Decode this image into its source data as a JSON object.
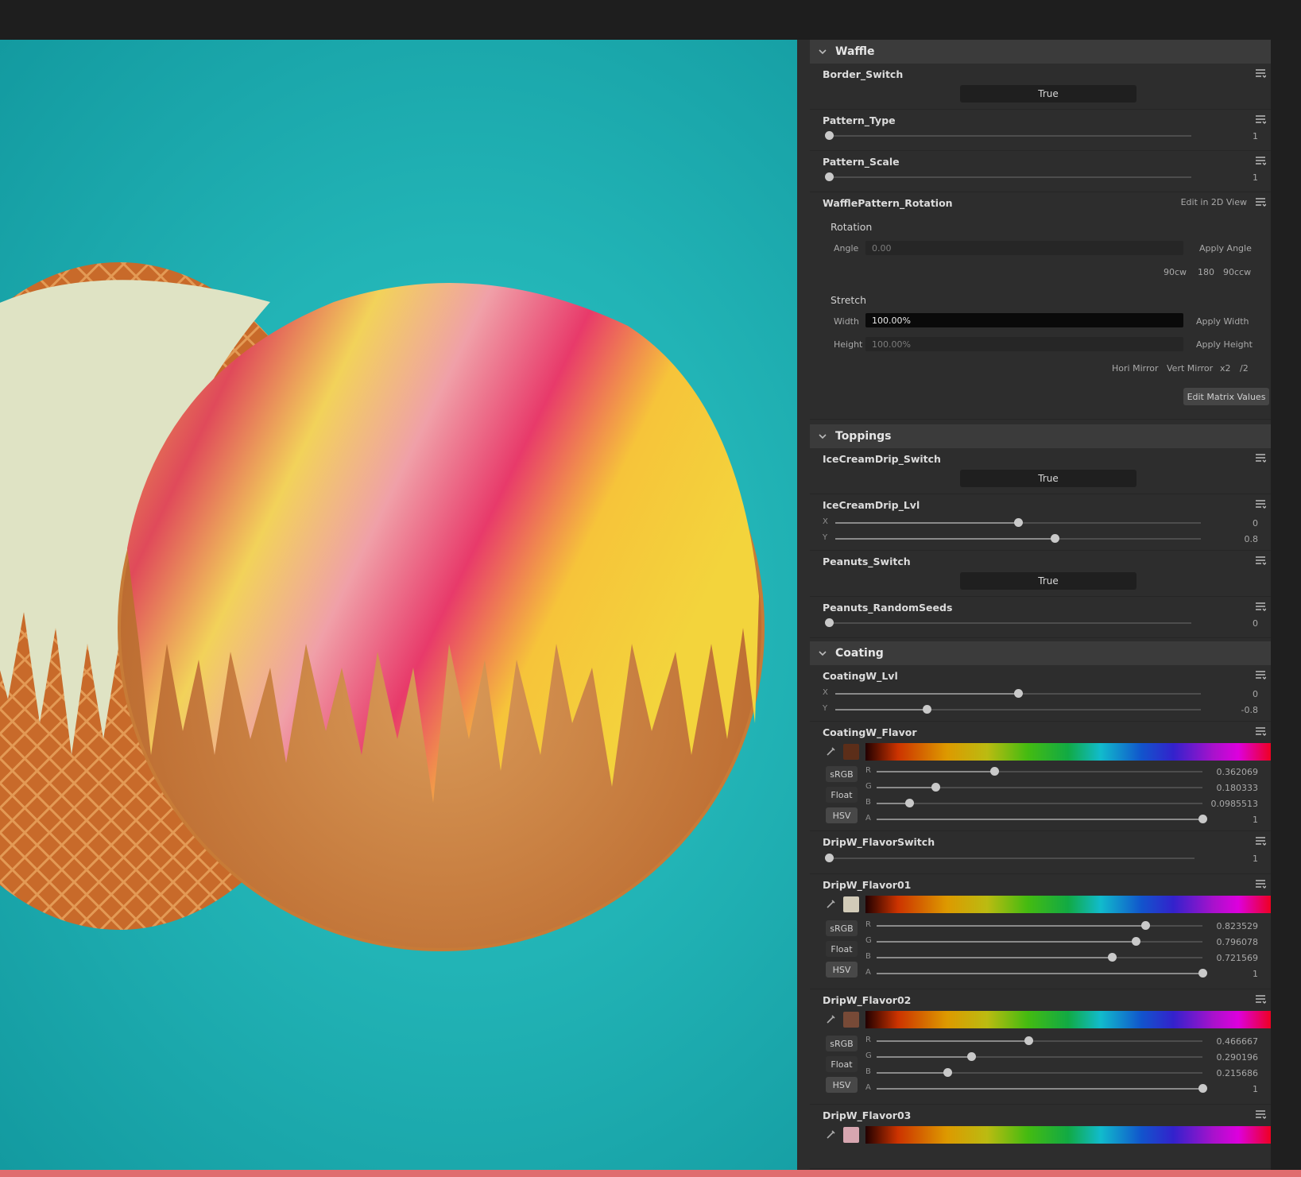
{
  "sections": {
    "waffle": "Waffle",
    "toppings": "Toppings",
    "coating": "Coating"
  },
  "params": {
    "border_switch": {
      "name": "Border_Switch",
      "value": "True"
    },
    "pattern_type": {
      "name": "Pattern_Type",
      "value": "1"
    },
    "pattern_scale": {
      "name": "Pattern_Scale",
      "value": "1"
    },
    "rotation": {
      "name": "WafflePattern_Rotation",
      "edit_2d": "Edit in 2D View",
      "rotation_label": "Rotation",
      "angle_label": "Angle",
      "angle_value": "0.00",
      "apply_angle": "Apply Angle",
      "btn_90cw": "90cw",
      "btn_180": "180",
      "btn_90ccw": "90ccw",
      "stretch_label": "Stretch",
      "width_label": "Width",
      "width_value": "100.00%",
      "apply_width": "Apply Width",
      "height_label": "Height",
      "height_value": "100.00%",
      "apply_height": "Apply Height",
      "hori_mirror": "Hori Mirror",
      "vert_mirror": "Vert Mirror",
      "x2": "x2",
      "div2": "/2",
      "edit_matrix": "Edit Matrix Values"
    },
    "icecream_switch": {
      "name": "IceCreamDrip_Switch",
      "value": "True"
    },
    "icecream_lvl": {
      "name": "IceCreamDrip_Lvl",
      "x_label": "X",
      "y_label": "Y",
      "x_value": "0",
      "y_value": "0.8"
    },
    "peanuts_switch": {
      "name": "Peanuts_Switch",
      "value": "True"
    },
    "peanuts_seeds": {
      "name": "Peanuts_RandomSeeds",
      "value": "0"
    },
    "coating_lvl": {
      "name": "CoatingW_Lvl",
      "x_label": "X",
      "y_label": "Y",
      "x_value": "0",
      "y_value": "-0.8"
    },
    "coating_flavor": {
      "name": "CoatingW_Flavor",
      "r": "0.362069",
      "g": "0.180333",
      "b": "0.0985513",
      "a": "1",
      "swatch": "#5c2e19"
    },
    "drip_switch": {
      "name": "DripW_FlavorSwitch",
      "value": "1"
    },
    "drip_flavor01": {
      "name": "DripW_Flavor01",
      "r": "0.823529",
      "g": "0.796078",
      "b": "0.721569",
      "a": "1",
      "swatch": "#d2cbb8"
    },
    "drip_flavor02": {
      "name": "DripW_Flavor02",
      "r": "0.466667",
      "g": "0.290196",
      "b": "0.215686",
      "a": "1",
      "swatch": "#774a37"
    },
    "drip_flavor03": {
      "name": "DripW_Flavor03",
      "swatch": "#d7a6b0"
    }
  },
  "color_labels": {
    "r": "R",
    "g": "G",
    "b": "B",
    "a": "A",
    "srgb": "sRGB",
    "float": "Float",
    "hsv": "HSV"
  }
}
